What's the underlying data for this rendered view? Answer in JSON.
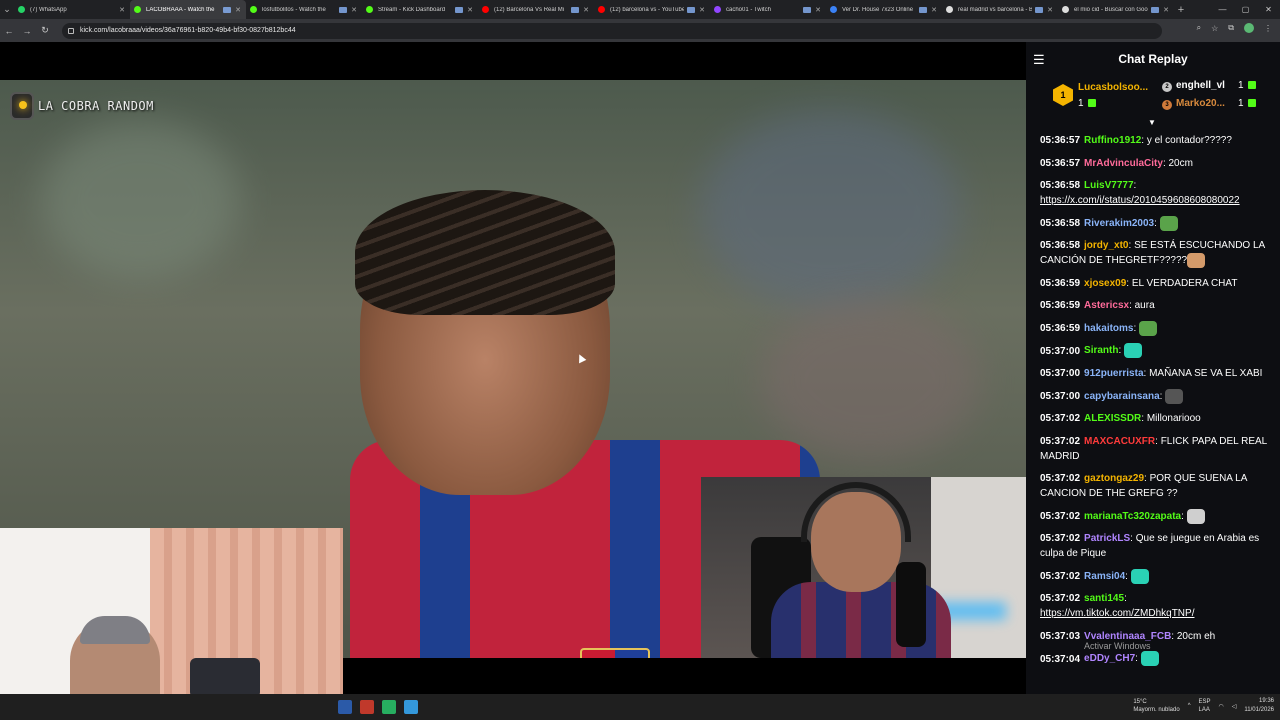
{
  "browser": {
    "tabs": [
      {
        "title": "(7) WhatsApp",
        "color": "#25d366",
        "active": false
      },
      {
        "title": "LACOBRAAA - Watch the",
        "color": "#53fc18",
        "active": true
      },
      {
        "title": "losfutbolitos - Watch the",
        "color": "#53fc18",
        "active": false
      },
      {
        "title": "Stream - Kick Dashboard",
        "color": "#53fc18",
        "active": false
      },
      {
        "title": "(12) Barcelona Vs Real Mi",
        "color": "#ff0000",
        "active": false
      },
      {
        "title": "(12) barcelona vs - YouTube",
        "color": "#ff0000",
        "active": false
      },
      {
        "title": "cacho01 - Twitch",
        "color": "#9146ff",
        "active": false
      },
      {
        "title": "Ver Dr. House 7x23 Online",
        "color": "#3b82f6",
        "active": false
      },
      {
        "title": "real madrid vs barcelona - B",
        "color": "#dddddd",
        "active": false
      },
      {
        "title": "el mio cid - Buscar con Goog",
        "color": "#dddddd",
        "active": false
      }
    ],
    "url": "kick.com/lacobraaa/videos/36a76961-b820-49b4-bf30-0827b812bc44"
  },
  "video": {
    "channel_overlay": "LA COBRA RANDOM"
  },
  "chat": {
    "title": "Chat Replay",
    "leaderboard": [
      {
        "rank": "1",
        "name": "Lucasbolsoo...",
        "count": "1"
      },
      {
        "rank": "2",
        "name": "enghell_vl",
        "count": "1"
      },
      {
        "rank": "3",
        "name": "Marko20...",
        "count": "1"
      }
    ],
    "messages": [
      {
        "time": "05:36:57",
        "user": "Ruffino1912",
        "color": "#53fc18",
        "text": "y el contador?????"
      },
      {
        "time": "05:36:57",
        "user": "MrAdvinculaCity",
        "color": "#ff6b9a",
        "text": "20cm"
      },
      {
        "time": "05:36:58",
        "user": "LuisV7777",
        "color": "#53fc18",
        "text": "",
        "link": "https://x.com/i/status/2010459608608080022"
      },
      {
        "time": "05:36:58",
        "user": "Riverakim2003",
        "color": "#8ab4f8",
        "text": "",
        "emote": "#5aa34a"
      },
      {
        "time": "05:36:58",
        "user": "jordy_xt0",
        "color": "#f4b400",
        "text": "SE ESTÁ ESCUCHANDO LA CANCIÓN DE THEGRETF?????",
        "emote": "#d49a6a"
      },
      {
        "time": "05:36:59",
        "user": "xjosex09",
        "color": "#f4b400",
        "text": "EL VERDADERA CHAT"
      },
      {
        "time": "05:36:59",
        "user": "Astericsx",
        "color": "#ff6b9a",
        "text": "aura"
      },
      {
        "time": "05:36:59",
        "user": "hakaitoms",
        "color": "#8ab4f8",
        "text": "",
        "emote": "#5aa34a"
      },
      {
        "time": "05:37:00",
        "user": "Siranth",
        "color": "#53fc18",
        "text": "",
        "emote": "#2ad1b5"
      },
      {
        "time": "05:37:00",
        "user": "912puerrista",
        "color": "#8ab4f8",
        "text": "MAÑANA SE VA EL XABI"
      },
      {
        "time": "05:37:00",
        "user": "capybarainsana",
        "color": "#8ab4f8",
        "text": "",
        "emote": "#555555"
      },
      {
        "time": "05:37:02",
        "user": "ALEXISSDR",
        "color": "#53fc18",
        "text": "Millonariooo"
      },
      {
        "time": "05:37:02",
        "user": "MAXCACUXFR",
        "color": "#ff3b3b",
        "text": "FLICK PAPA DEL REAL MADRID"
      },
      {
        "time": "05:37:02",
        "user": "gaztongaz29",
        "color": "#f4b400",
        "text": "POR QUE SUENA LA CANCION DE THE GREFG ??"
      },
      {
        "time": "05:37:02",
        "user": "marianaTc320zapata",
        "color": "#53fc18",
        "text": "",
        "emote": "#cfcfcf"
      },
      {
        "time": "05:37:02",
        "user": "PatrickLS",
        "color": "#b085ff",
        "text": "Que se juegue en Arabia es culpa de Pique"
      },
      {
        "time": "05:37:02",
        "user": "Ramsi04",
        "color": "#8ab4f8",
        "text": "",
        "emote": "#2ad1b5"
      },
      {
        "time": "05:37:02",
        "user": "santi145",
        "color": "#53fc18",
        "text": "",
        "link": "https://vm.tiktok.com/ZMDhkqTNP/"
      },
      {
        "time": "05:37:03",
        "user": "Vvalentinaaa_FCB",
        "color": "#b085ff",
        "text": "20cm eh"
      },
      {
        "time": "05:37:04",
        "user": "eDDy_CH7",
        "color": "#b085ff",
        "text": "",
        "emote": "#2ad1b5"
      }
    ],
    "watermark": "Activar Windows"
  },
  "taskbar": {
    "weather_temp": "15°C",
    "weather_desc": "Mayorm. nublado",
    "lang_top": "ESP",
    "lang_bottom": "LAA",
    "time": "19:36",
    "date": "11/01/2026"
  }
}
